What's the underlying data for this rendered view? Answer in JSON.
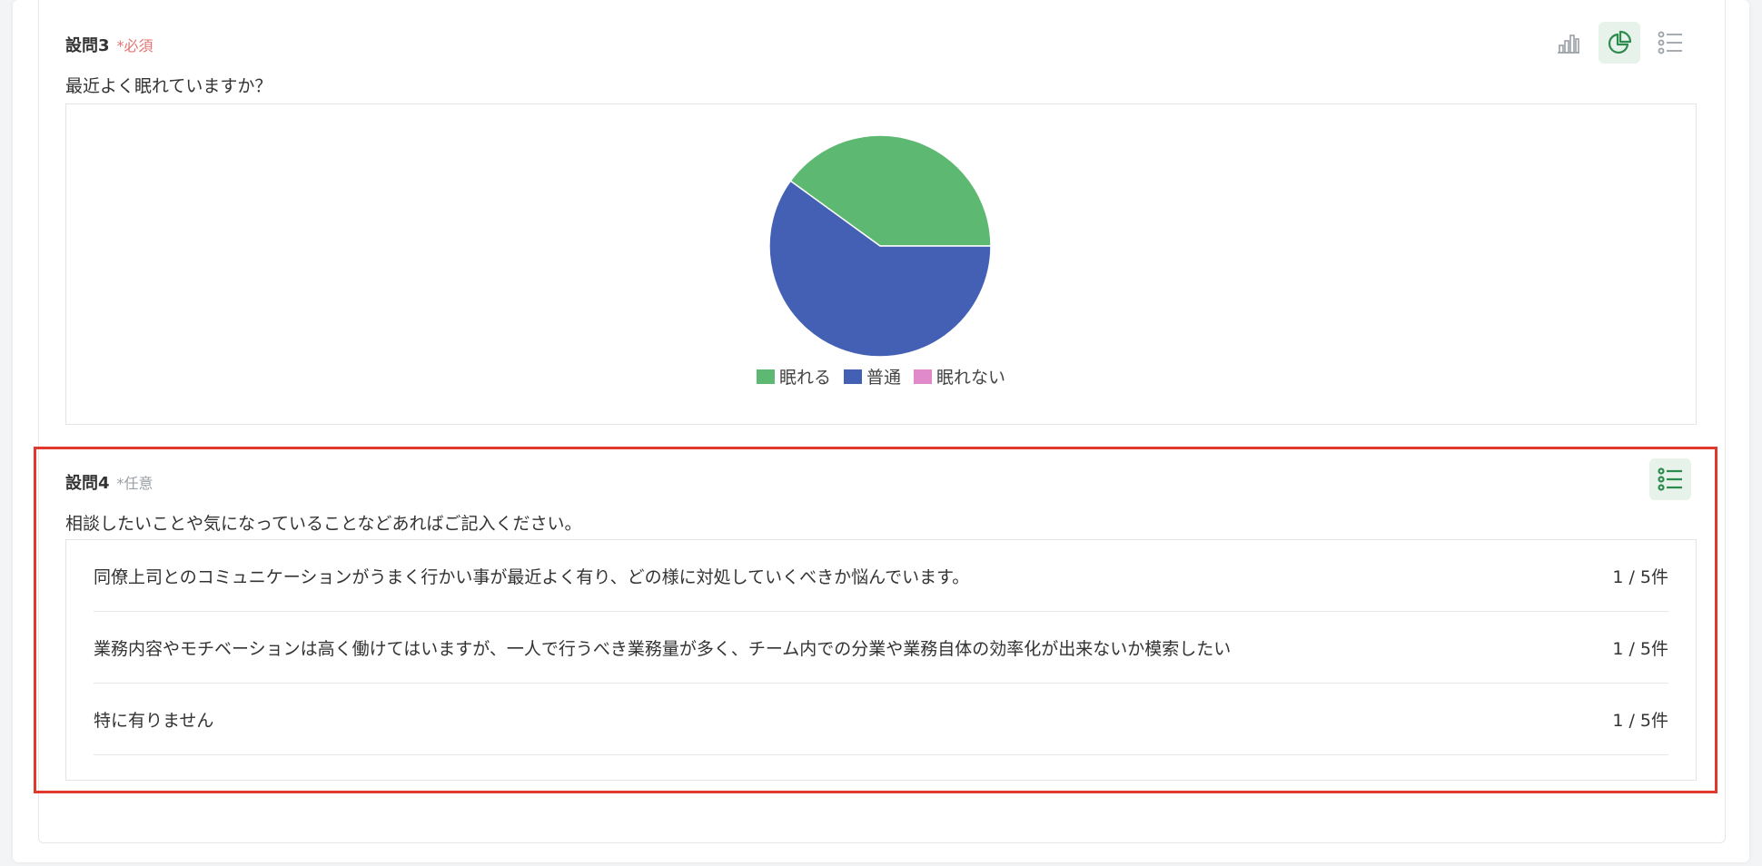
{
  "q3": {
    "number": "設問3",
    "badge": "*必須",
    "question": "最近よく眠れていますか？",
    "view_buttons": [
      {
        "icon": "bar-chart-icon",
        "active": false
      },
      {
        "icon": "pie-chart-icon",
        "active": true
      },
      {
        "icon": "list-icon",
        "active": false
      }
    ]
  },
  "chart_data": {
    "type": "pie",
    "title": "",
    "slices": [
      {
        "label": "眠れる",
        "value": 40,
        "color": "#5db872"
      },
      {
        "label": "普通",
        "value": 60,
        "color": "#4360b5"
      },
      {
        "label": "眠れない",
        "value": 0,
        "color": "#e08acb"
      }
    ],
    "legend_position": "bottom"
  },
  "q4": {
    "number": "設問4",
    "badge": "*任意",
    "question": "相談したいことや気になっていることなどあればご記入ください。",
    "view_buttons": [
      {
        "icon": "list-icon",
        "active": true
      }
    ],
    "answers": [
      {
        "text": "同僚上司とのコミュニケーションがうまく行かい事が最近よく有り、どの様に対処していくべきか悩んでいます。",
        "count": "1 / 5件"
      },
      {
        "text": "業務内容やモチベーションは高く働けてはいますが、一人で行うべき業務量が多く、チーム内での分業や業務自体の効率化が出来ないか模索したい",
        "count": "1 / 5件"
      },
      {
        "text": "特に有りません",
        "count": "1 / 5件"
      }
    ]
  },
  "colors": {
    "accent_green": "#2e8b4e",
    "required_red": "#e57373",
    "highlight_red": "#e03a2f"
  }
}
